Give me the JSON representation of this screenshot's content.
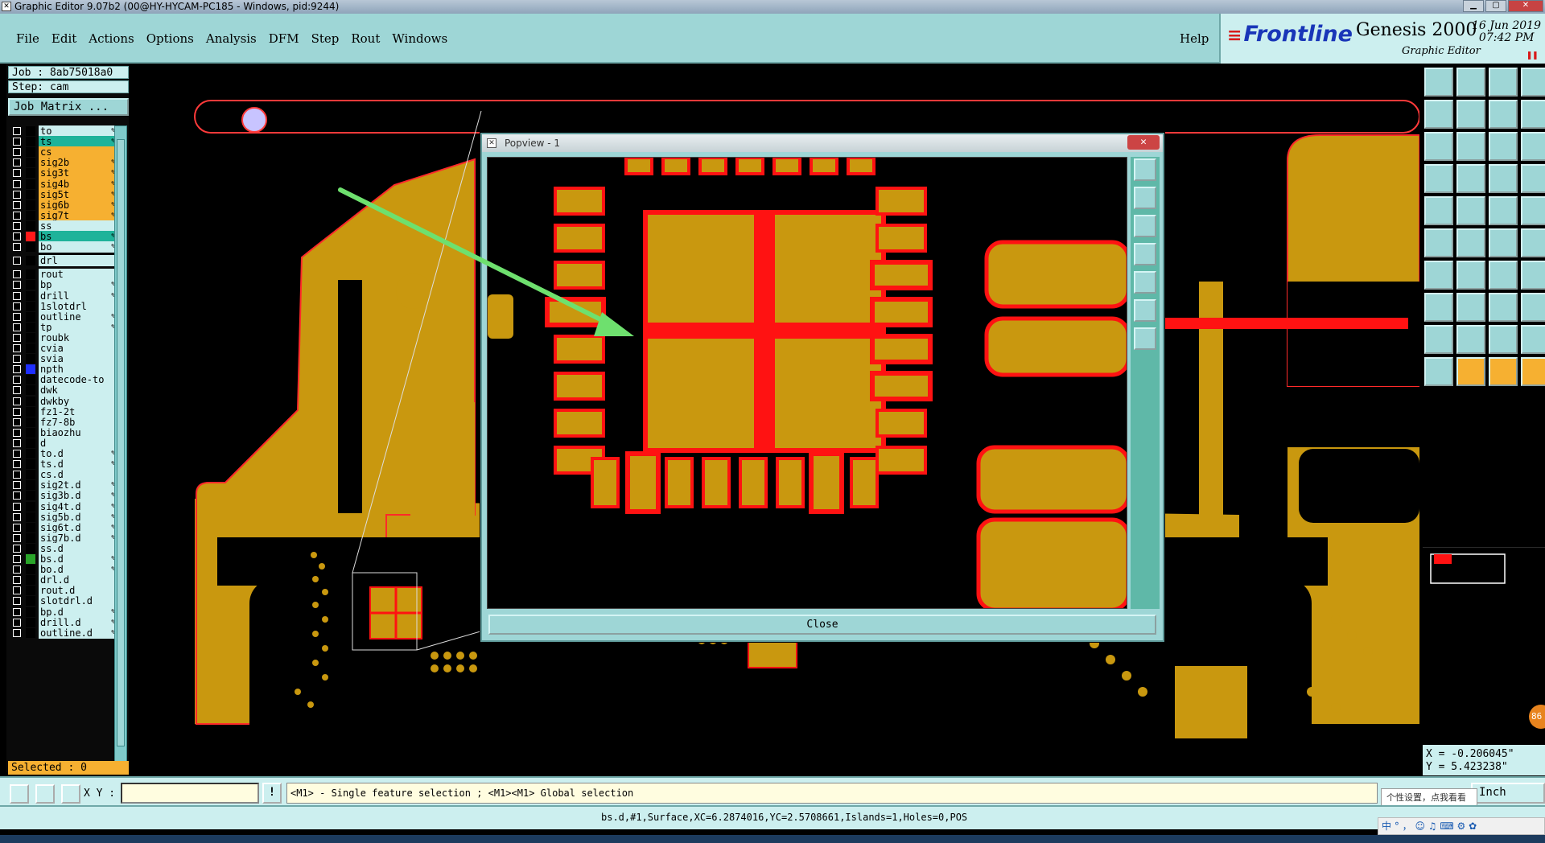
{
  "window": {
    "title": "Graphic Editor 9.07b2 (00@HY-HYCAM-PC185 - Windows, pid:9244)"
  },
  "menu": [
    "File",
    "Edit",
    "Actions",
    "Options",
    "Analysis",
    "DFM",
    "Step",
    "Rout",
    "Windows"
  ],
  "help_label": "Help",
  "brand": {
    "logo": "Frontline",
    "product": "Genesis 2000",
    "subtitle": "Graphic Editor",
    "date": "16 Jun 2019",
    "time": "07:42 PM"
  },
  "job": {
    "job_label": "Job : 8ab75018a0",
    "step_label": "Step: cam",
    "matrix_button": "Job Matrix ..."
  },
  "layers": [
    {
      "name": "to",
      "style": "plain",
      "color": "",
      "edit": true
    },
    {
      "name": "ts",
      "style": "green",
      "color": "",
      "edit": true
    },
    {
      "name": "cs",
      "style": "sig",
      "color": "",
      "edit": false
    },
    {
      "name": "sig2b",
      "style": "sig",
      "color": "",
      "edit": true
    },
    {
      "name": "sig3t",
      "style": "sig",
      "color": "",
      "edit": true
    },
    {
      "name": "sig4b",
      "style": "sig",
      "color": "",
      "edit": true
    },
    {
      "name": "sig5t",
      "style": "sig",
      "color": "",
      "edit": true
    },
    {
      "name": "sig6b",
      "style": "sig",
      "color": "",
      "edit": true
    },
    {
      "name": "sig7t",
      "style": "sig",
      "color": "",
      "edit": true
    },
    {
      "name": "ss",
      "style": "plain",
      "color": "",
      "edit": false
    },
    {
      "name": "bs",
      "style": "green",
      "color": "#ff1a1a",
      "edit": true
    },
    {
      "name": "bo",
      "style": "plain",
      "color": "",
      "edit": true
    },
    {
      "name": "drl",
      "style": "plain",
      "color": "",
      "edit": false
    },
    {
      "name": "rout",
      "style": "plain",
      "color": "",
      "edit": false
    },
    {
      "name": "bp",
      "style": "plain",
      "color": "",
      "edit": true
    },
    {
      "name": "drill",
      "style": "plain",
      "color": "",
      "edit": true
    },
    {
      "name": "1slotdrl",
      "style": "plain",
      "color": "",
      "edit": false
    },
    {
      "name": "outline",
      "style": "plain",
      "color": "",
      "edit": true
    },
    {
      "name": "tp",
      "style": "plain",
      "color": "",
      "edit": true
    },
    {
      "name": "roubk",
      "style": "plain",
      "color": "",
      "edit": false
    },
    {
      "name": "cvia",
      "style": "plain",
      "color": "",
      "edit": false
    },
    {
      "name": "svia",
      "style": "plain",
      "color": "",
      "edit": false
    },
    {
      "name": "npth",
      "style": "plain",
      "color": "#1f2fff",
      "edit": false
    },
    {
      "name": "datecode-to",
      "style": "plain",
      "color": "",
      "edit": false
    },
    {
      "name": "dwk",
      "style": "plain",
      "color": "",
      "edit": false
    },
    {
      "name": "dwkby",
      "style": "plain",
      "color": "",
      "edit": false
    },
    {
      "name": "fz1-2t",
      "style": "plain",
      "color": "",
      "edit": false
    },
    {
      "name": "fz7-8b",
      "style": "plain",
      "color": "",
      "edit": false
    },
    {
      "name": "biaozhu",
      "style": "plain",
      "color": "",
      "edit": false
    },
    {
      "name": "d",
      "style": "plain",
      "color": "",
      "edit": false
    },
    {
      "name": "to.d",
      "style": "plain",
      "color": "",
      "edit": true
    },
    {
      "name": "ts.d",
      "style": "plain",
      "color": "",
      "edit": true
    },
    {
      "name": "cs.d",
      "style": "plain",
      "color": "",
      "edit": false
    },
    {
      "name": "sig2t.d",
      "style": "plain",
      "color": "",
      "edit": true
    },
    {
      "name": "sig3b.d",
      "style": "plain",
      "color": "",
      "edit": true
    },
    {
      "name": "sig4t.d",
      "style": "plain",
      "color": "",
      "edit": true
    },
    {
      "name": "sig5b.d",
      "style": "plain",
      "color": "",
      "edit": true
    },
    {
      "name": "sig6t.d",
      "style": "plain",
      "color": "",
      "edit": true
    },
    {
      "name": "sig7b.d",
      "style": "plain",
      "color": "",
      "edit": true
    },
    {
      "name": "ss.d",
      "style": "plain",
      "color": "",
      "edit": false
    },
    {
      "name": "bs.d",
      "style": "plain",
      "color": "#2aa52a",
      "edit": true
    },
    {
      "name": "bo.d",
      "style": "plain",
      "color": "",
      "edit": true
    },
    {
      "name": "drl.d",
      "style": "plain",
      "color": "",
      "edit": false
    },
    {
      "name": "rout.d",
      "style": "plain",
      "color": "",
      "edit": false
    },
    {
      "name": "slotdrl.d",
      "style": "plain",
      "color": "",
      "edit": false
    },
    {
      "name": "bp.d",
      "style": "plain",
      "color": "",
      "edit": true
    },
    {
      "name": "drill.d",
      "style": "plain",
      "color": "",
      "edit": true
    },
    {
      "name": "outline.d",
      "style": "plain",
      "color": "",
      "edit": true
    }
  ],
  "selected_label": "Selected : 0",
  "popview": {
    "title": "Popview - 1",
    "close_button": "Close"
  },
  "coords": {
    "x": "X = -0.206045\"",
    "y": "Y = 5.423238\""
  },
  "command": {
    "xy_label": "X Y :",
    "xy_value": "",
    "prompt": "<M1> - Single feature selection ; <M1><M1> Global selection",
    "units": "Inch"
  },
  "status_text": "bs.d,#1,Surface,XC=6.2874016,YC=2.5708661,Islands=1,Holes=0,POS",
  "tooltip": "个性设置，点我看看",
  "ime_label": "中",
  "badge": "86",
  "colors": {
    "copper": "#c9980f",
    "mask": "#ff1212",
    "panel": "#9ed6d6",
    "arrow": "#6ee06e"
  }
}
